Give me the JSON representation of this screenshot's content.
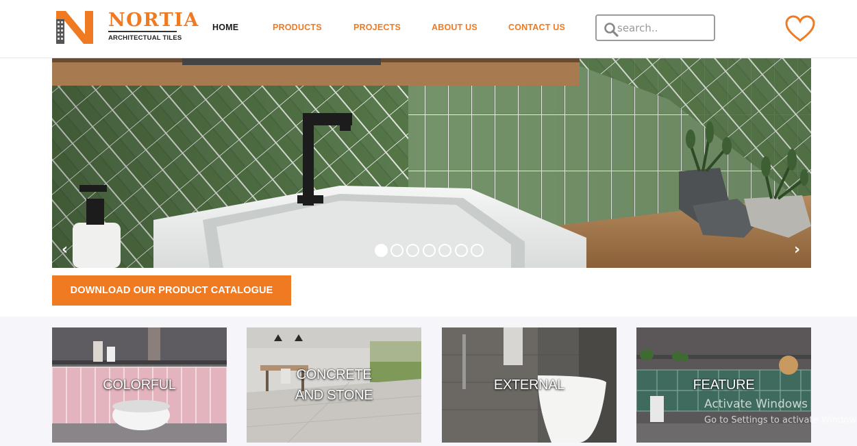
{
  "brand": {
    "name": "NORTIA",
    "tagline": "ARCHITECTUAL TILES",
    "accent": "#f07a22"
  },
  "nav": {
    "items": [
      {
        "label": "HOME",
        "active": true
      },
      {
        "label": "PRODUCTS",
        "active": false
      },
      {
        "label": "PROJECTS",
        "active": false
      },
      {
        "label": "ABOUT US",
        "active": false
      },
      {
        "label": "CONTACT US",
        "active": false
      }
    ]
  },
  "search": {
    "placeholder": "search..",
    "icon": "search-icon"
  },
  "header_icons": {
    "favorites": "heart-icon"
  },
  "slider": {
    "prev": "‹",
    "next": "›",
    "slide_count": 7,
    "active_index": 0
  },
  "cta": {
    "label": "DOWNLOAD OUR PRODUCT CATALOGUE"
  },
  "categories": [
    {
      "label": "COLORFUL"
    },
    {
      "label_line1": "CONCRETE",
      "label_line2": "AND STONE"
    },
    {
      "label": "EXTERNAL"
    },
    {
      "label": "FEATURE"
    }
  ],
  "os_watermark": {
    "title": "Activate Windows",
    "subtitle": "Go to Settings to activate Windows."
  }
}
